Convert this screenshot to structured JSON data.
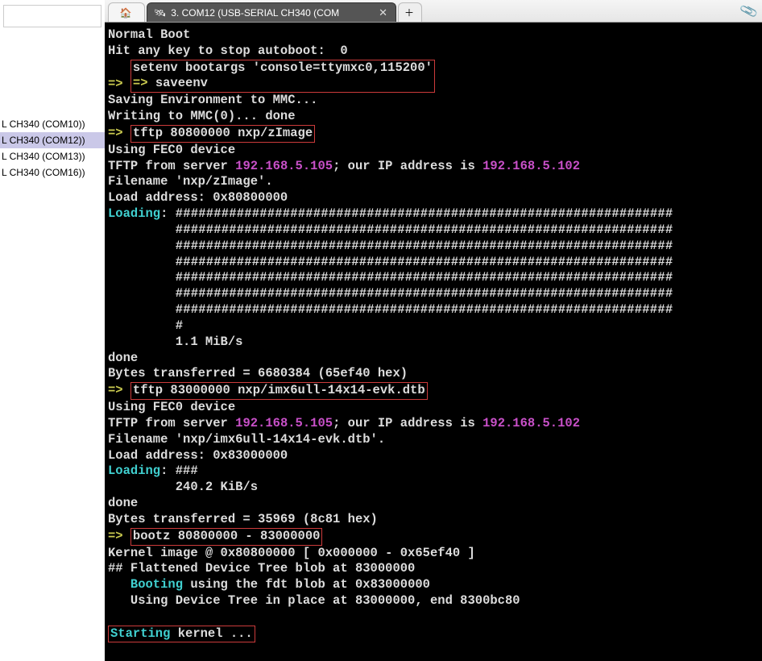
{
  "sidebar": {
    "items": [
      {
        "label": "L CH340 (COM10))",
        "selected": false
      },
      {
        "label": "L CH340 (COM12))",
        "selected": true
      },
      {
        "label": "L CH340 (COM13))",
        "selected": false
      },
      {
        "label": "L CH340 (COM16))",
        "selected": false
      }
    ]
  },
  "tabs": {
    "home_icon": "🏠",
    "active": {
      "icon": "🛰",
      "label": "3. COM12  (USB-SERIAL CH340 (COM",
      "close": "✕"
    },
    "add_icon": "＋",
    "attach_icon": "📎"
  },
  "terminal": {
    "l01": "Normal Boot",
    "l02": "Hit any key to stop autoboot:  0",
    "l03_prompt": "=> ",
    "l03_cmd1": "setenv bootargs 'console=ttymxc0,115200'",
    "l04_prompt": "=> ",
    "l04_cmd2": "saveenv",
    "l05": "Saving Environment to MMC...",
    "l06": "Writing to MMC(0)... done",
    "l07_prompt": "=> ",
    "l07_cmd": "tftp 80800000 nxp/zImage",
    "l08": "Using FEC0 device",
    "l09a": "TFTP from server ",
    "l09b": "192.168.5.105",
    "l09c": "; our IP address is ",
    "l09d": "192.168.5.102",
    "l10": "Filename 'nxp/zImage'.",
    "l11": "Load address: 0x80800000",
    "l12a": "Loading",
    "l12b": ": ",
    "hashfull": "#################################################################",
    "hashtail": "#",
    "l13rate": "         1.1 MiB/s",
    "l14": "done",
    "l15": "Bytes transferred = 6680384 (65ef40 hex)",
    "l16_prompt": "=> ",
    "l16_cmd": "tftp 83000000 nxp/imx6ull-14x14-evk.dtb",
    "l17": "Using FEC0 device",
    "l18a": "TFTP from server ",
    "l18b": "192.168.5.105",
    "l18c": "; our IP address is ",
    "l18d": "192.168.5.102",
    "l19": "Filename 'nxp/imx6ull-14x14-evk.dtb'.",
    "l20": "Load address: 0x83000000",
    "l21a": "Loading",
    "l21b": ": ###",
    "l21rate": "         240.2 KiB/s",
    "l22": "done",
    "l23": "Bytes transferred = 35969 (8c81 hex)",
    "l24_prompt": "=> ",
    "l24_cmd": "bootz 80800000 - 83000000",
    "l25": "Kernel image @ 0x80800000 [ 0x000000 - 0x65ef40 ]",
    "l26": "## Flattened Device Tree blob at 83000000",
    "l27a": "   ",
    "l27b": "Booting",
    "l27c": " using the fdt blob at 0x83000000",
    "l28": "   Using Device Tree in place at 83000000, end 8300bc80",
    "blank": "",
    "l29a": "Starting",
    "l29b": " kernel ..."
  }
}
